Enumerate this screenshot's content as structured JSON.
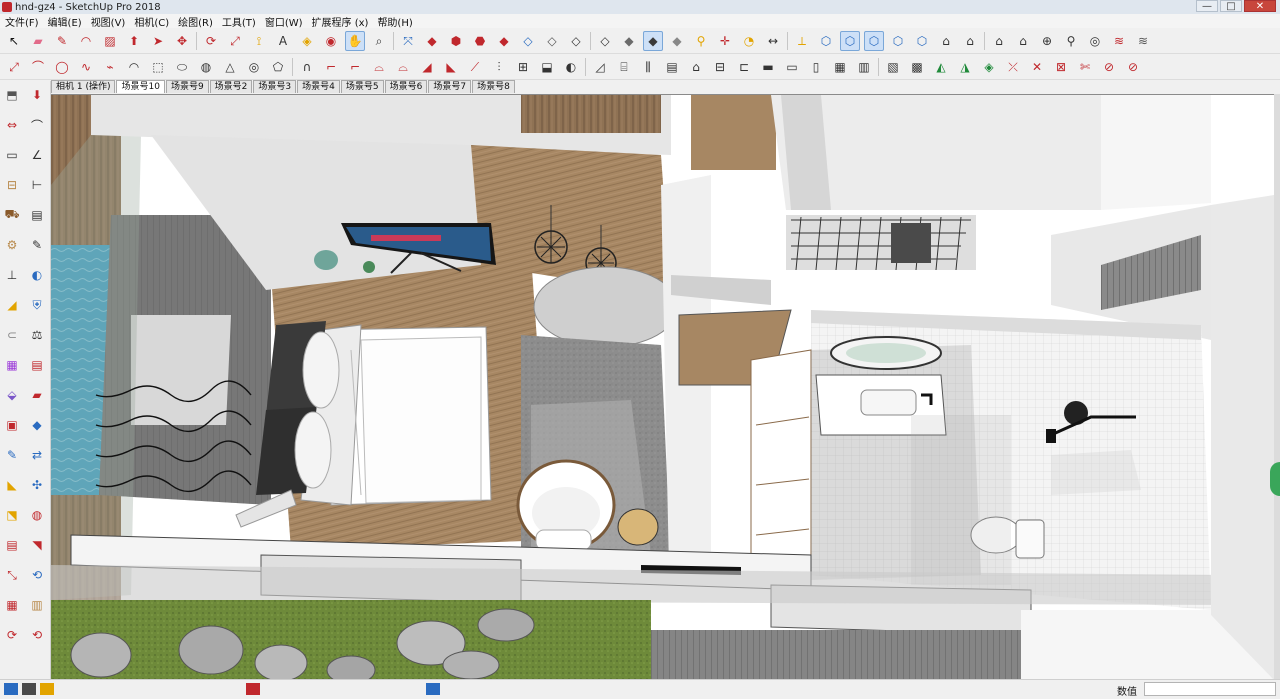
{
  "window": {
    "title": "hnd-gz4 - SketchUp Pro 2018",
    "controls": {
      "minimize": "—",
      "maximize": "□",
      "close": "✕"
    }
  },
  "menu": [
    "文件(F)",
    "编辑(E)",
    "视图(V)",
    "相机(C)",
    "绘图(R)",
    "工具(T)",
    "窗口(W)",
    "扩展程序 (x)",
    "帮助(H)"
  ],
  "toolbar_row1": [
    {
      "name": "select-icon",
      "glyph": "↖",
      "color": "#111111"
    },
    {
      "name": "eraser-icon",
      "glyph": "▰",
      "color": "#e26b8a"
    },
    {
      "name": "pencil-icon",
      "glyph": "✎",
      "color": "#c0282d"
    },
    {
      "name": "arc-icon",
      "glyph": "◠",
      "color": "#c0282d"
    },
    {
      "name": "rectangle-icon",
      "glyph": "▨",
      "color": "#c0282d"
    },
    {
      "name": "push-pull-icon",
      "glyph": "⬆",
      "color": "#c0282d"
    },
    {
      "name": "follow-me-icon",
      "glyph": "➤",
      "color": "#c0282d"
    },
    {
      "name": "move-icon",
      "glyph": "✥",
      "color": "#c0282d"
    },
    {
      "name": "rotate-icon",
      "glyph": "⟳",
      "color": "#c0282d"
    },
    {
      "name": "scale-icon",
      "glyph": "⤢",
      "color": "#c0282d"
    },
    {
      "name": "tape-measure-icon",
      "glyph": "⟟",
      "color": "#e2a400"
    },
    {
      "name": "text-icon",
      "glyph": "A",
      "color": "#333333"
    },
    {
      "name": "paint-bucket-icon",
      "glyph": "◈",
      "color": "#e2a400"
    },
    {
      "name": "orbit-icon",
      "glyph": "◉",
      "color": "#c0282d"
    },
    {
      "name": "pan-icon",
      "glyph": "✋",
      "color": "#e2a400"
    },
    {
      "name": "zoom-icon",
      "glyph": "⌕",
      "color": "#333333"
    },
    {
      "name": "zoom-extents-icon",
      "glyph": "⤧",
      "color": "#2a6bc0"
    },
    {
      "name": "component-icon",
      "glyph": "◆",
      "color": "#c0282d"
    },
    {
      "name": "warehouse-icon",
      "glyph": "⬢",
      "color": "#c0282d"
    },
    {
      "name": "extension-icon",
      "glyph": "⬣",
      "color": "#c0282d"
    },
    {
      "name": "ruby-icon",
      "glyph": "◆",
      "color": "#c0282d"
    },
    {
      "name": "xray-icon",
      "glyph": "◇",
      "color": "#2a6bc0"
    },
    {
      "name": "back-edges-icon",
      "glyph": "◇",
      "color": "#555555"
    },
    {
      "name": "wireframe-icon",
      "glyph": "◇",
      "color": "#333333"
    },
    {
      "name": "hidden-line-icon",
      "glyph": "◇",
      "color": "#333333"
    },
    {
      "name": "shaded-icon",
      "glyph": "◆",
      "color": "#6b6b6b"
    },
    {
      "name": "shaded-textures-icon",
      "glyph": "◆",
      "color": "#3a3a3a"
    },
    {
      "name": "monochrome-icon",
      "glyph": "◆",
      "color": "#888888"
    },
    {
      "name": "walk-icon",
      "glyph": "⚲",
      "color": "#e2a400"
    },
    {
      "name": "axes-icon",
      "glyph": "✛",
      "color": "#c0282d"
    },
    {
      "name": "protractor-icon",
      "glyph": "◔",
      "color": "#e2a400"
    },
    {
      "name": "dimension-icon",
      "glyph": "↔",
      "color": "#333333"
    },
    {
      "name": "section-plane-icon",
      "glyph": "⟂",
      "color": "#e2a400"
    },
    {
      "name": "iso-view-icon",
      "glyph": "⬡",
      "color": "#2a6bc0"
    },
    {
      "name": "top-view-icon",
      "glyph": "⬡",
      "color": "#2a6bc0"
    },
    {
      "name": "front-view-icon",
      "glyph": "⬡",
      "color": "#2a6bc0"
    },
    {
      "name": "right-view-icon",
      "glyph": "⬡",
      "color": "#2a6bc0"
    },
    {
      "name": "back-view-icon",
      "glyph": "⬡",
      "color": "#2a6bc0"
    },
    {
      "name": "house-icon",
      "glyph": "⌂",
      "color": "#333333"
    },
    {
      "name": "house-front-icon",
      "glyph": "⌂",
      "color": "#333333"
    },
    {
      "name": "house-side-icon",
      "glyph": "⌂",
      "color": "#333333"
    },
    {
      "name": "house-back-icon",
      "glyph": "⌂",
      "color": "#333333"
    },
    {
      "name": "geo-location-icon",
      "glyph": "⊕",
      "color": "#333333"
    },
    {
      "name": "position-camera-icon",
      "glyph": "⚲",
      "color": "#333333"
    },
    {
      "name": "look-around-icon",
      "glyph": "◎",
      "color": "#333333"
    },
    {
      "name": "layers-icon",
      "glyph": "≋",
      "color": "#c0282d"
    },
    {
      "name": "styles-icon",
      "glyph": "≋",
      "color": "#555555"
    }
  ],
  "toolbar_row2": [
    {
      "name": "plugin-line-icon",
      "glyph": "⤢",
      "color": "#c0282d"
    },
    {
      "name": "plugin-curve-icon",
      "glyph": "⌒",
      "color": "#c0282d"
    },
    {
      "name": "plugin-circle-icon",
      "glyph": "◯",
      "color": "#c0282d"
    },
    {
      "name": "plugin-bezier-icon",
      "glyph": "∿",
      "color": "#c0282d"
    },
    {
      "name": "plugin-polyline-icon",
      "glyph": "⌁",
      "color": "#c0282d"
    },
    {
      "name": "plugin-arc-icon",
      "glyph": "◠",
      "color": "#333333"
    },
    {
      "name": "plugin-cube-icon",
      "glyph": "⬚",
      "color": "#333333"
    },
    {
      "name": "plugin-cylinder-icon",
      "glyph": "⬭",
      "color": "#333333"
    },
    {
      "name": "plugin-sphere-icon",
      "glyph": "◍",
      "color": "#333333"
    },
    {
      "name": "plugin-cone-icon",
      "glyph": "△",
      "color": "#333333"
    },
    {
      "name": "plugin-torus-icon",
      "glyph": "◎",
      "color": "#333333"
    },
    {
      "name": "plugin-prism-icon",
      "glyph": "⬠",
      "color": "#333333"
    },
    {
      "name": "plugin-pipe-icon",
      "glyph": "∩",
      "color": "#333333"
    },
    {
      "name": "plugin-offset-icon",
      "glyph": "⌐",
      "color": "#c0282d"
    },
    {
      "name": "plugin-extrude-icon",
      "glyph": "⌐",
      "color": "#c0282d"
    },
    {
      "name": "plugin-loft-icon",
      "glyph": "⌓",
      "color": "#c0282d"
    },
    {
      "name": "plugin-skin-icon",
      "glyph": "⌓",
      "color": "#c0282d"
    },
    {
      "name": "plugin-fillet-icon",
      "glyph": "◢",
      "color": "#c0282d"
    },
    {
      "name": "plugin-chamfer-icon",
      "glyph": "◣",
      "color": "#c0282d"
    },
    {
      "name": "plugin-weld-icon",
      "glyph": "⟋",
      "color": "#c0282d"
    },
    {
      "name": "plugin-array-icon",
      "glyph": "⫶",
      "color": "#333333"
    },
    {
      "name": "plugin-grid-icon",
      "glyph": "⊞",
      "color": "#333333"
    },
    {
      "name": "plugin-shell-icon",
      "glyph": "⬓",
      "color": "#333333"
    },
    {
      "name": "plugin-round-icon",
      "glyph": "◐",
      "color": "#333333"
    },
    {
      "name": "plugin-bevel-icon",
      "glyph": "◿",
      "color": "#333333"
    },
    {
      "name": "plugin-stair-icon",
      "glyph": "⌸",
      "color": "#333333"
    },
    {
      "name": "plugin-rail-icon",
      "glyph": "⫼",
      "color": "#333333"
    },
    {
      "name": "plugin-wall-icon",
      "glyph": "▤",
      "color": "#333333"
    },
    {
      "name": "plugin-roof-icon",
      "glyph": "⌂",
      "color": "#333333"
    },
    {
      "name": "plugin-window-icon",
      "glyph": "⊟",
      "color": "#333333"
    },
    {
      "name": "plugin-door-icon",
      "glyph": "⊏",
      "color": "#333333"
    },
    {
      "name": "plugin-slab-icon",
      "glyph": "▬",
      "color": "#333333"
    },
    {
      "name": "plugin-beam-icon",
      "glyph": "▭",
      "color": "#333333"
    },
    {
      "name": "plugin-column-icon",
      "glyph": "▯",
      "color": "#333333"
    },
    {
      "name": "plugin-tile-icon",
      "glyph": "▦",
      "color": "#333333"
    },
    {
      "name": "plugin-stripe-icon",
      "glyph": "▥",
      "color": "#333333"
    },
    {
      "name": "plugin-hatch-icon",
      "glyph": "▧",
      "color": "#333333"
    },
    {
      "name": "plugin-texture-icon",
      "glyph": "▩",
      "color": "#333333"
    },
    {
      "name": "plugin-terrain-icon",
      "glyph": "◭",
      "color": "#1f8a3a"
    },
    {
      "name": "plugin-landscape-icon",
      "glyph": "◮",
      "color": "#1f8a3a"
    },
    {
      "name": "plugin-sandbox-icon",
      "glyph": "◈",
      "color": "#1f8a3a"
    },
    {
      "name": "plugin-weld-edges-icon",
      "glyph": "⤫",
      "color": "#c0282d"
    },
    {
      "name": "plugin-cross-icon",
      "glyph": "✕",
      "color": "#c0282d"
    },
    {
      "name": "plugin-frame-icon",
      "glyph": "⊠",
      "color": "#c0282d"
    },
    {
      "name": "plugin-cut-icon",
      "glyph": "✄",
      "color": "#c0282d"
    },
    {
      "name": "plugin-slash-icon",
      "glyph": "⊘",
      "color": "#c0282d"
    },
    {
      "name": "plugin-no-icon",
      "glyph": "⊘",
      "color": "#c0282d"
    }
  ],
  "left_toolbar": [
    {
      "name": "make-component-icon",
      "glyph": "⬒",
      "color": "#555555"
    },
    {
      "name": "push-down-icon",
      "glyph": "⬇",
      "color": "#c0282d"
    },
    {
      "name": "distribute-icon",
      "glyph": "⇔",
      "color": "#c0282d"
    },
    {
      "name": "curve-tool-icon",
      "glyph": "⌒",
      "color": "#333333"
    },
    {
      "name": "line-tool-icon",
      "glyph": "▭",
      "color": "#333333"
    },
    {
      "name": "angle-tool-icon",
      "glyph": "∠",
      "color": "#333333"
    },
    {
      "name": "ruler-icon",
      "glyph": "⊟",
      "color": "#b8894a"
    },
    {
      "name": "dimension-tool-icon",
      "glyph": "⊢",
      "color": "#333333"
    },
    {
      "name": "truck-icon",
      "glyph": "⛟",
      "color": "#8a5a2a"
    },
    {
      "name": "stack-icon",
      "glyph": "▤",
      "color": "#333333"
    },
    {
      "name": "gear-icon",
      "glyph": "⚙",
      "color": "#b8894a"
    },
    {
      "name": "pen-tool-icon",
      "glyph": "✎",
      "color": "#333333"
    },
    {
      "name": "join-icon",
      "glyph": "⊥",
      "color": "#333333"
    },
    {
      "name": "shade-icon",
      "glyph": "◐",
      "color": "#2a6bc0"
    },
    {
      "name": "fill-icon",
      "glyph": "◢",
      "color": "#e2a400"
    },
    {
      "name": "lock-icon",
      "glyph": "⛨",
      "color": "#2a6bc0"
    },
    {
      "name": "sandbox-icon",
      "glyph": "⊂",
      "color": "#888888"
    },
    {
      "name": "balance-icon",
      "glyph": "⚖",
      "color": "#333333"
    },
    {
      "name": "color-swatch-icon",
      "glyph": "▦",
      "color": "#9b3ad8"
    },
    {
      "name": "red-rows-icon",
      "glyph": "▤",
      "color": "#c0282d"
    },
    {
      "name": "mesh-icon",
      "glyph": "⬙",
      "color": "#7b57c9"
    },
    {
      "name": "eraser-red-icon",
      "glyph": "▰",
      "color": "#c0282d"
    },
    {
      "name": "gradient-icon",
      "glyph": "▣",
      "color": "#c0282d"
    },
    {
      "name": "diamond-blue-icon",
      "glyph": "◆",
      "color": "#2a6bc0"
    },
    {
      "name": "edit-pen-icon",
      "glyph": "✎",
      "color": "#2a6bc0"
    },
    {
      "name": "flip-icon",
      "glyph": "⇄",
      "color": "#2a6bc0"
    },
    {
      "name": "cut-face-icon",
      "glyph": "◣",
      "color": "#e2a400"
    },
    {
      "name": "arrows-icon",
      "glyph": "✣",
      "color": "#2a6bc0"
    },
    {
      "name": "stamp-icon",
      "glyph": "⬔",
      "color": "#e2a400"
    },
    {
      "name": "red-circle-icon",
      "glyph": "◍",
      "color": "#c0282d"
    },
    {
      "name": "text-block-icon",
      "glyph": "▤",
      "color": "#c0282d"
    },
    {
      "name": "tag-icon",
      "glyph": "◥",
      "color": "#c0282d"
    },
    {
      "name": "scale-red-icon",
      "glyph": "⤡",
      "color": "#c0282d"
    },
    {
      "name": "rotate-blue-icon",
      "glyph": "⟲",
      "color": "#2a6bc0"
    },
    {
      "name": "color-picker-icon",
      "glyph": "▦",
      "color": "#c0282d"
    },
    {
      "name": "folder-icon",
      "glyph": "▥",
      "color": "#b8894a"
    },
    {
      "name": "redo-icon",
      "glyph": "⟳",
      "color": "#c0282d"
    },
    {
      "name": "undo-icon",
      "glyph": "⟲",
      "color": "#c0282d"
    }
  ],
  "scene_tabs": [
    {
      "label": "相机 1 (操作)",
      "active": false
    },
    {
      "label": "场景号10",
      "active": true
    },
    {
      "label": "场景号9",
      "active": false
    },
    {
      "label": "场景号2",
      "active": false
    },
    {
      "label": "场景号3",
      "active": false
    },
    {
      "label": "场景号4",
      "active": false
    },
    {
      "label": "场景号5",
      "active": false
    },
    {
      "label": "场景号6",
      "active": false
    },
    {
      "label": "场景号7",
      "active": false
    },
    {
      "label": "场景号8",
      "active": false
    }
  ],
  "status": {
    "measurement_label": "数值",
    "measurement_value": ""
  },
  "colors": {
    "wood_floor": "#a78763",
    "wall": "#dcdcdc",
    "terrazzo": "#8c8c8c",
    "glass": "#9fb7c6",
    "pool": "#3fa3c8",
    "grass": "#6e8a3a"
  }
}
